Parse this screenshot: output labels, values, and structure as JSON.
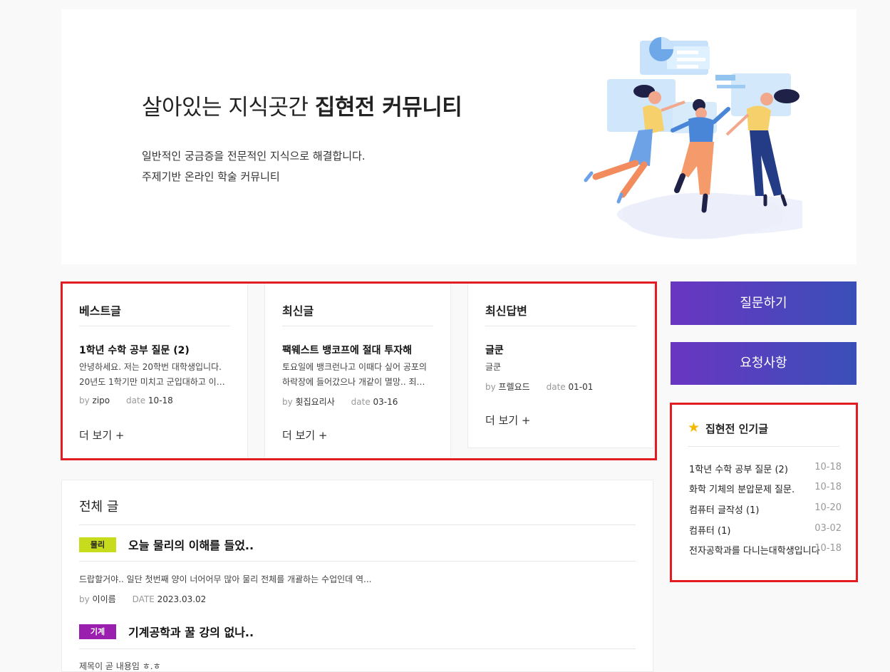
{
  "hero": {
    "title_plain": "살아있는 지식곳간 ",
    "title_highlight": "집현전 커뮤니티",
    "sub_line1": "일반적인 궁금증을 전문적인 지식으로 해결합니다.",
    "sub_line2": "주제기반 온라인 학술 커뮤니티"
  },
  "cards": [
    {
      "title": "베스트글",
      "post_title": "1학년 수학 공부 질문 (2)",
      "body_line1": "안녕하세요. 저는 20학번 대학생입니다.",
      "body_line2": "20년도 1학기만 미치고 군입대하고 이번 ...",
      "by_label": "by",
      "author": "zipo",
      "date_label": "date",
      "date": "10-18",
      "more": "더 보기 +"
    },
    {
      "title": "최신글",
      "post_title": "팩웨스트 뱅코프에 절대 투자해",
      "body_line1": "토요일에 뱅크런나고 이때다 싶어 공포의",
      "body_line2": "하락장에 들어갔으나 개같이 멸망.. 죄송...",
      "by_label": "by",
      "author": "횟집요리사",
      "date_label": "date",
      "date": "03-16",
      "more": "더 보기 +"
    },
    {
      "title": "최신답변",
      "post_title": "글쿤",
      "body_line1": "글쿤",
      "body_line2": "",
      "by_label": "by",
      "author": "프렐요드",
      "date_label": "date",
      "date": "01-01",
      "more": "더 보기 +"
    }
  ],
  "side": {
    "ask_button": "질문하기",
    "request_button": "요청사항"
  },
  "popular": {
    "title": "집현전 인기글",
    "items": [
      {
        "title": "1학년 수학 공부 질문 (2)",
        "date": "10-18"
      },
      {
        "title": "화학 기체의 분압문제 질문.",
        "date": "10-18"
      },
      {
        "title": "컴퓨터 글작성 (1)",
        "date": "10-20"
      },
      {
        "title": "컴퓨터 (1)",
        "date": "03-02"
      },
      {
        "title": "전자공학과를 다니는대학생입니다",
        "date": "10-18"
      }
    ]
  },
  "all_posts": {
    "title": "전체 글",
    "posts": [
      {
        "tag": "물리",
        "tag_bg": "#c8dc1e",
        "tag_fg": "#222222",
        "title": "오늘 물리의 이해를 들었..",
        "body": "드랍할거야.. 일단 첫번째 양이 너어어무 많아 물리 전체를 개괄하는 수업인데 역...",
        "by_label": "by",
        "author": "이이름",
        "date_label": "DATE",
        "date": "2023.03.02"
      },
      {
        "tag": "기계",
        "tag_bg": "#9b1fae",
        "tag_fg": "#ffffff",
        "title": "기계공학과 꿀 강의 없나..",
        "body": "제목이 곧 내용임 ㅎ.ㅎ",
        "by_label": "",
        "author": "",
        "date_label": "",
        "date": ""
      }
    ]
  },
  "colors": {
    "accent_gradient_start": "#6a36c2",
    "accent_gradient_end": "#3a4fb8",
    "highlight_box": "#e31b23",
    "star": "#f5b800"
  }
}
